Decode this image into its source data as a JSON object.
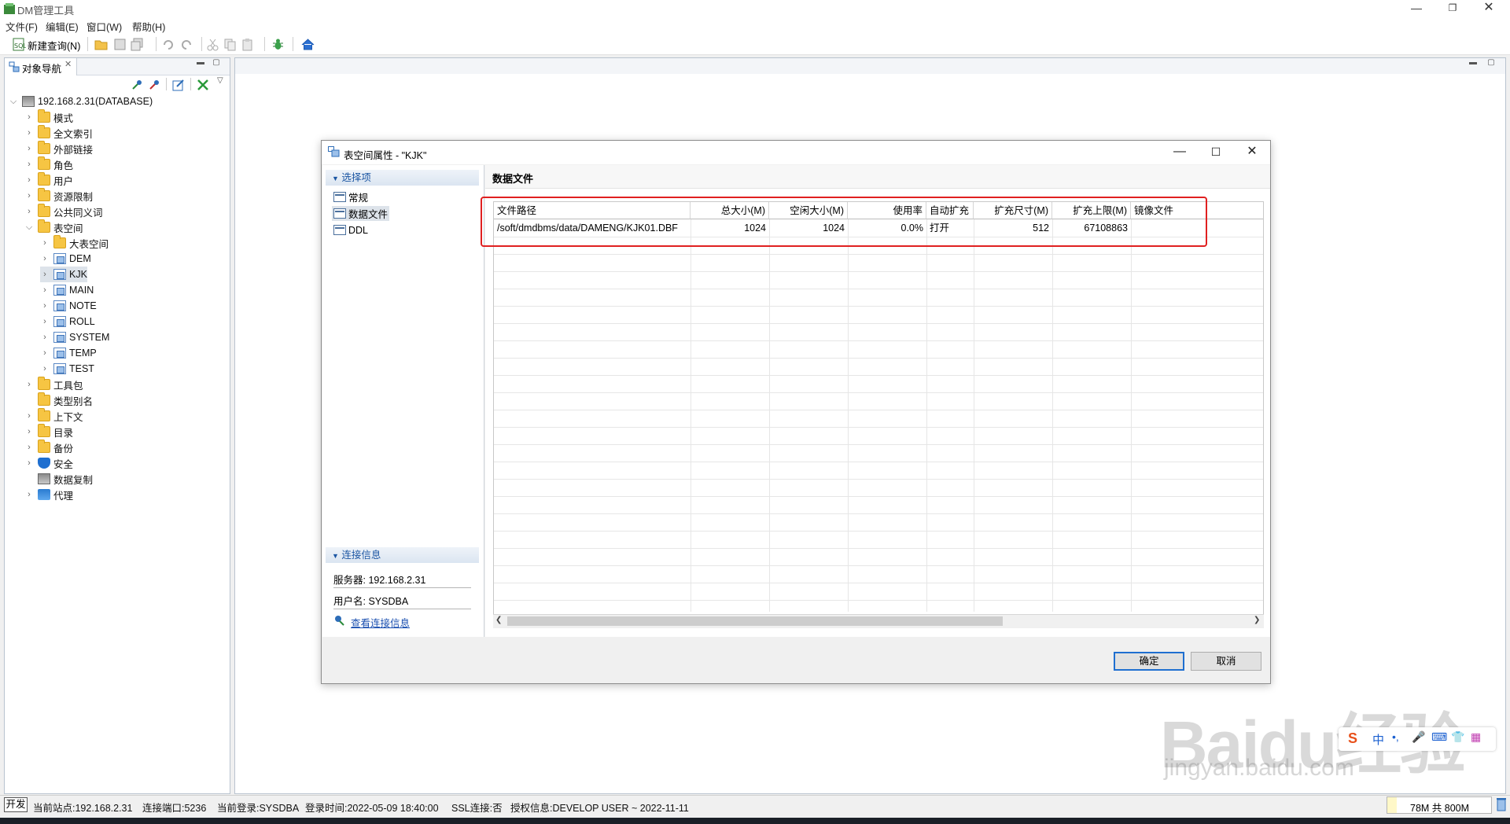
{
  "window": {
    "title": "DM管理工具"
  },
  "menu": [
    "文件(F)",
    "编辑(E)",
    "窗口(W)",
    "帮助(H)"
  ],
  "toolbar": {
    "new_query": "新建查询(N)"
  },
  "nav": {
    "tab_label": "对象导航",
    "root": "192.168.2.31(DATABASE)",
    "items": [
      {
        "label": "模式"
      },
      {
        "label": "全文索引"
      },
      {
        "label": "外部链接"
      },
      {
        "label": "角色"
      },
      {
        "label": "用户"
      },
      {
        "label": "资源限制"
      },
      {
        "label": "公共同义词"
      },
      {
        "label": "表空间"
      },
      {
        "label": "大表空间"
      },
      {
        "label": "DEM"
      },
      {
        "label": "KJK"
      },
      {
        "label": "MAIN"
      },
      {
        "label": "NOTE"
      },
      {
        "label": "ROLL"
      },
      {
        "label": "SYSTEM"
      },
      {
        "label": "TEMP"
      },
      {
        "label": "TEST"
      },
      {
        "label": "工具包"
      },
      {
        "label": "类型别名"
      },
      {
        "label": "上下文"
      },
      {
        "label": "目录"
      },
      {
        "label": "备份"
      },
      {
        "label": "安全"
      },
      {
        "label": "数据复制"
      },
      {
        "label": "代理"
      }
    ]
  },
  "dialog": {
    "title": "表空间属性 - \"KJK\"",
    "options_header": "选择项",
    "options": [
      "常规",
      "数据文件",
      "DDL"
    ],
    "conn_header": "连接信息",
    "server": "服务器: 192.168.2.31",
    "user": "用户名: SYSDBA",
    "view_conn": "查看连接信息",
    "section_title": "数据文件",
    "columns": [
      "文件路径",
      "总大小(M)",
      "空闲大小(M)",
      "使用率",
      "自动扩充",
      "扩充尺寸(M)",
      "扩充上限(M)",
      "镜像文件"
    ],
    "row": [
      "/soft/dmdbms/data/DAMENG/KJK01.DBF",
      "1024",
      "1024",
      "0.0%",
      "打开",
      "512",
      "67108863",
      ""
    ],
    "ok": "确定",
    "cancel": "取消"
  },
  "status": {
    "mode": "开发",
    "site": "当前站点:192.168.2.31",
    "port": "连接端口:5236",
    "login": "当前登录:SYSDBA",
    "login_time": "登录时间:2022-05-09 18:40:00",
    "ssl": "SSL连接:否",
    "license": "授权信息:DEVELOP USER ~ 2022-11-11",
    "memory": "78M 共 800M"
  },
  "watermark": {
    "main": "Baidu经验",
    "sub": "jingyan.baidu.com"
  },
  "ime": {
    "lang": "中"
  }
}
